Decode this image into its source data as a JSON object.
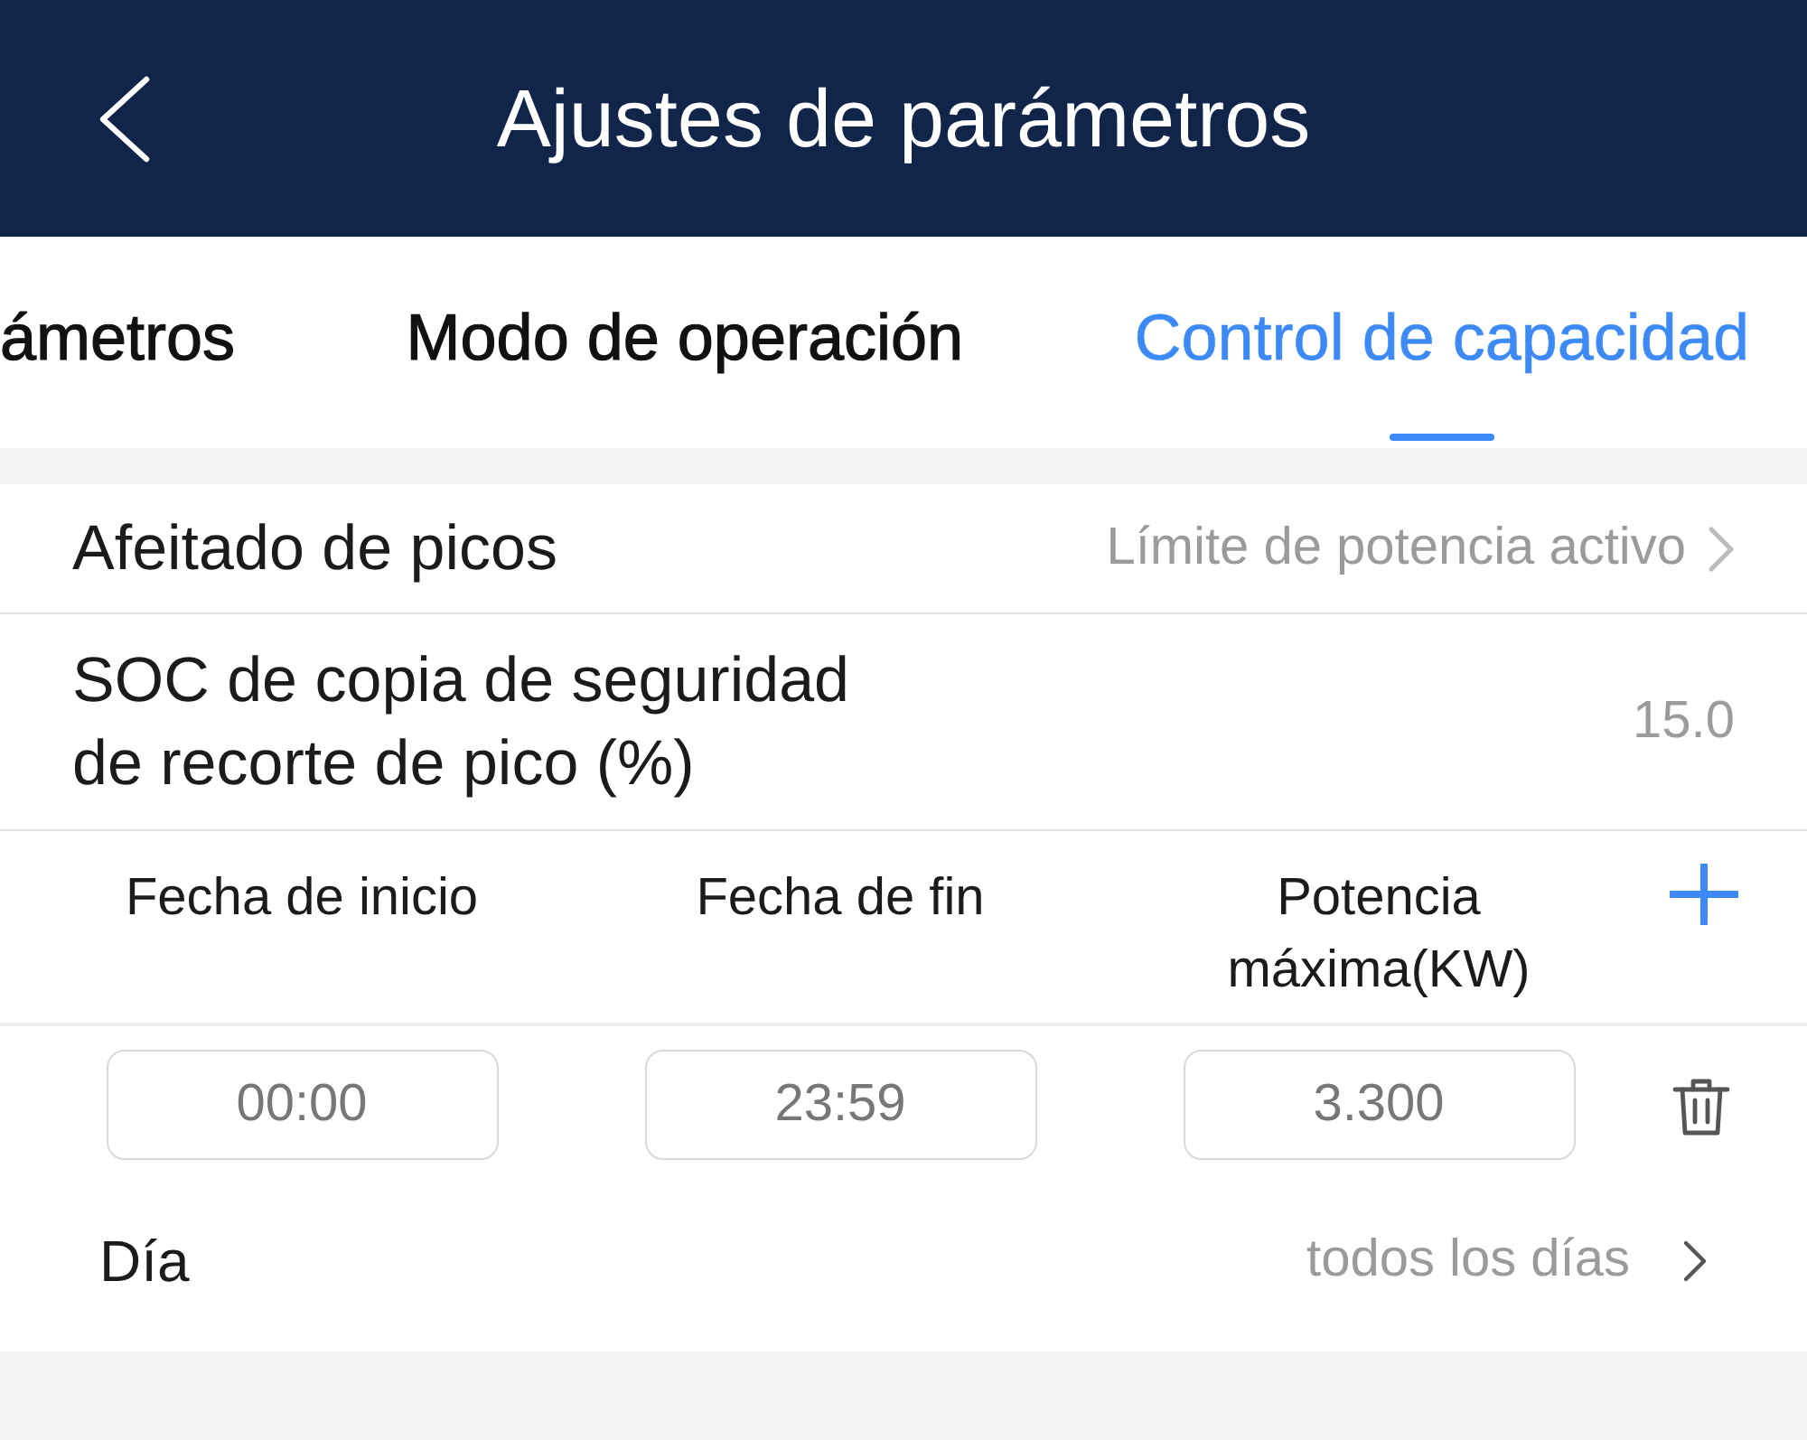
{
  "header": {
    "title": "Ajustes de parámetros"
  },
  "tabs": [
    {
      "label": "ámetros",
      "selected": false
    },
    {
      "label": "Modo de operación",
      "selected": false
    },
    {
      "label": "Control de capacidad",
      "selected": true
    }
  ],
  "settings": [
    {
      "kind": "link",
      "label": "Afeitado de picos",
      "value": "Límite de potencia activo"
    },
    {
      "kind": "value",
      "label": "SOC de copia de seguridad de recorte de pico (%)",
      "value": "15.0"
    }
  ],
  "schedule": {
    "columns": [
      "Fecha de inicio",
      "Fecha de fin",
      "Potencia máxima(KW)"
    ],
    "entries": [
      {
        "start": "00:00",
        "end": "23:59",
        "power": "3.300",
        "day": {
          "label": "Día",
          "value": "todos los días"
        }
      }
    ]
  }
}
